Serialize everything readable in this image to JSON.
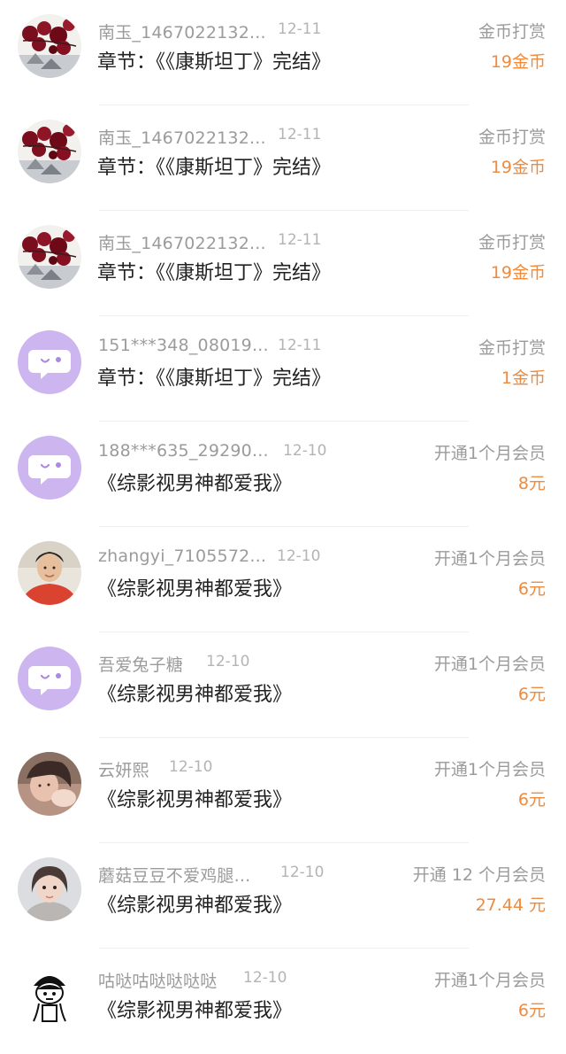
{
  "accent_color": "#f08a3c",
  "records": [
    {
      "avatar": "red-flower-avatar",
      "user": "南玉_1467022132...",
      "date": "12-11",
      "item": "章节：《《康斯坦丁》完结》",
      "type": "金币打赏",
      "amount": "19金币"
    },
    {
      "avatar": "red-flower-avatar",
      "user": "南玉_1467022132...",
      "date": "12-11",
      "item": "章节：《《康斯坦丁》完结》",
      "type": "金币打赏",
      "amount": "19金币"
    },
    {
      "avatar": "red-flower-avatar",
      "user": "南玉_1467022132...",
      "date": "12-11",
      "item": "章节：《《康斯坦丁》完结》",
      "type": "金币打赏",
      "amount": "19金币"
    },
    {
      "avatar": "default-chat-avatar",
      "user": "151***348_08019...",
      "date": "12-11",
      "item": "章节：《《康斯坦丁》完结》",
      "type": "金币打赏",
      "amount": "1金币"
    },
    {
      "avatar": "default-chat-avatar",
      "user": "188***635_29290...",
      "date": "12-10",
      "item": "《综影视男神都爱我》",
      "type": "开通1个月会员",
      "amount": "8元"
    },
    {
      "avatar": "boy-red-shirt-avatar",
      "user": "zhangyi_7105572...",
      "date": "12-10",
      "item": "《综影视男神都爱我》",
      "type": "开通1个月会员",
      "amount": "6元"
    },
    {
      "avatar": "default-chat-avatar",
      "user": "吾爱兔子糖",
      "date": "12-10",
      "item": "《综影视男神都爱我》",
      "type": "开通1个月会员",
      "amount": "6元"
    },
    {
      "avatar": "girl-photo-avatar",
      "user": "云妍熙",
      "date": "12-10",
      "item": "《综影视男神都爱我》",
      "type": "开通1个月会员",
      "amount": "6元"
    },
    {
      "avatar": "girl-portrait-avatar",
      "user": "蘑菇豆豆不爱鸡腿...",
      "date": "12-10",
      "item": "《综影视男神都爱我》",
      "type": "开通 12 个月会员",
      "amount": "27.44 元"
    },
    {
      "avatar": "cartoon-face-avatar",
      "user": "咕哒咕哒哒哒哒",
      "date": "12-10",
      "item": "《综影视男神都爱我》",
      "type": "开通1个月会员",
      "amount": "6元"
    }
  ]
}
